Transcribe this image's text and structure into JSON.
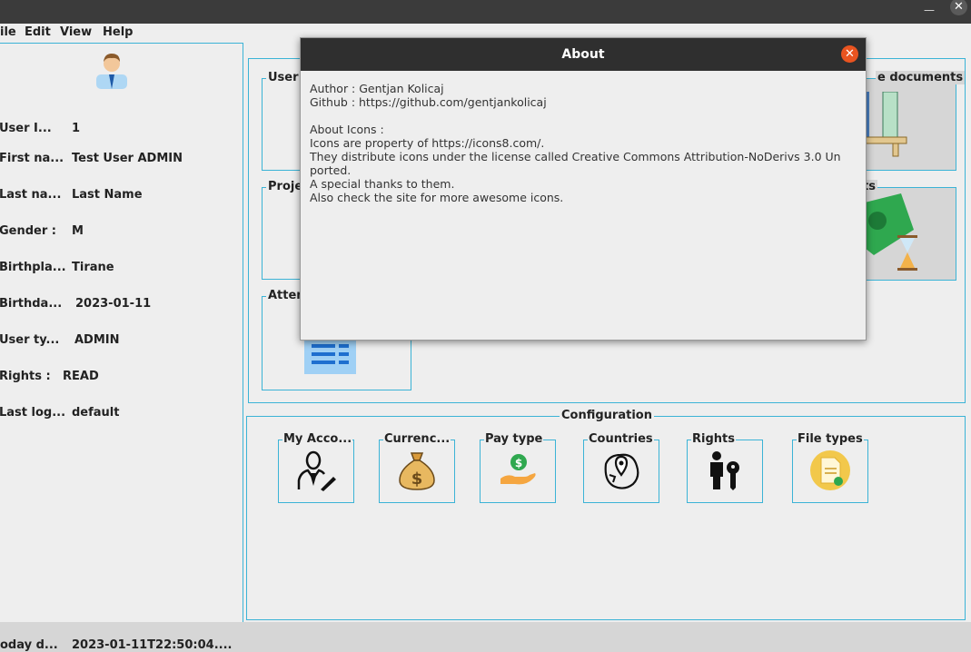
{
  "window": {
    "minimize": "—",
    "close": "✕"
  },
  "menu": [
    "ile",
    "Edit",
    "View",
    "Help"
  ],
  "user": {
    "fields": [
      {
        "label": "User I...",
        "value": "1"
      },
      {
        "label": "First na...",
        "value": "Test User ADMIN"
      },
      {
        "label": "Last na...",
        "value": "Last Name"
      },
      {
        "label": "Gender :",
        "value": "M"
      },
      {
        "label": "Birthpla...",
        "value": "Tirane"
      },
      {
        "label": "Birthda...",
        "value": "2023-01-11"
      },
      {
        "label": "User ty...",
        "value": "ADMIN"
      },
      {
        "label": "Rights  :",
        "value": "READ"
      },
      {
        "label": "Last log...",
        "value": "default"
      }
    ]
  },
  "modules": {
    "user_title": "User",
    "project_title": "Proje",
    "attendance_title": "Atten",
    "documents_title": "e documents",
    "payments_title": "ts"
  },
  "configuration": {
    "title": "Configuration",
    "items": [
      {
        "label": "My Acco...",
        "icon": "user-edit-icon"
      },
      {
        "label": "Currenc...",
        "icon": "money-bag-icon"
      },
      {
        "label": "Pay type",
        "icon": "hand-coin-icon"
      },
      {
        "label": "Countries",
        "icon": "globe-map-icon"
      },
      {
        "label": "Rights",
        "icon": "person-key-icon"
      },
      {
        "label": "File types",
        "icon": "file-icon"
      }
    ]
  },
  "status": {
    "label": "oday d...",
    "value": "2023-01-11T22:50:04...."
  },
  "about": {
    "title": "About",
    "close": "✕",
    "lines": [
      "Author : Gentjan Kolicaj",
      "Github : https://github.com/gentjankolicaj",
      "",
      "About Icons :",
      "Icons are property of https://icons8.com/.",
      "They distribute icons under the license called Creative Commons Attribution-NoDerivs 3.0 Un",
      "ported.",
      "A special thanks to them.",
      "Also check the site for more awesome icons."
    ]
  },
  "colors": {
    "accent": "#3bb3d6",
    "close": "#e95420",
    "titlebar": "#2f2f2f"
  }
}
